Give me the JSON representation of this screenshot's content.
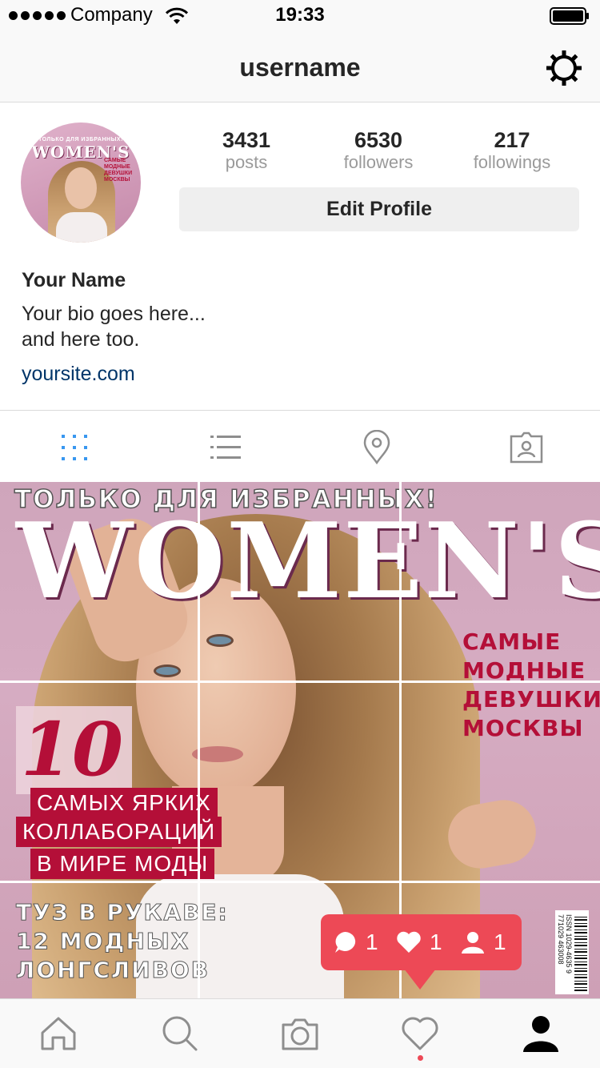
{
  "status_bar": {
    "carrier": "Company",
    "time": "19:33"
  },
  "nav": {
    "title": "username"
  },
  "profile": {
    "avatar_cover": {
      "top_line": "ТОЛЬКО ДЛЯ ИЗБРАННЫХ!",
      "title": "WOMEN'S",
      "side_lines": [
        "САМЫЕ",
        "МОДНЫЕ",
        "ДЕВУШКИ",
        "МОСКВЫ"
      ]
    },
    "stats": [
      {
        "value": "3431",
        "label": "posts"
      },
      {
        "value": "6530",
        "label": "followers"
      },
      {
        "value": "217",
        "label": "followings"
      }
    ],
    "edit_button": "Edit Profile",
    "name": "Your Name",
    "bio_line1": "Your bio goes here...",
    "bio_line2": "and here too.",
    "website": "yoursite.com"
  },
  "tabs": {
    "active": "grid",
    "active_color": "#3897f0",
    "inactive_color": "#8e8e8e",
    "items": [
      "grid-icon",
      "list-icon",
      "location-pin-icon",
      "tagged-photos-icon"
    ]
  },
  "post_grid": {
    "cover": {
      "top_line": "ТОЛЬКО ДЛЯ ИЗБРАННЫХ!",
      "title": "WOMEN'S",
      "right_lines": [
        "САМЫЕ",
        "МОДНЫЕ",
        "ДЕВУШКИ",
        "МОСКВЫ"
      ],
      "big_number": "10",
      "red_lines": [
        "САМЫХ ЯРКИХ",
        "КОЛЛАБОРАЦИЙ",
        "В МИРЕ МОДЫ"
      ],
      "bottom_lines": [
        "ТУЗ В РУКАВЕ:",
        "12 МОДНЫХ",
        "ЛОНГСЛИВОВ"
      ],
      "barcode_text": "ISSN 1029-4635 9 771029 463008",
      "accent_color": "#b40f38"
    }
  },
  "notification": {
    "color": "#ed4956",
    "comments": "1",
    "likes": "1",
    "follows": "1"
  },
  "tab_bar": {
    "items": [
      "home-icon",
      "search-icon",
      "camera-icon",
      "activity-heart-icon",
      "profile-icon"
    ],
    "active": "profile-icon"
  }
}
